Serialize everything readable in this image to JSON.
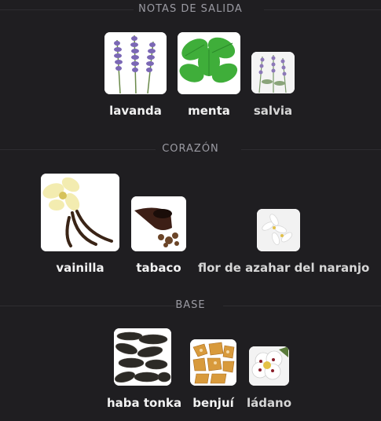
{
  "sections": {
    "top": {
      "title": "NOTAS DE SALIDA",
      "notes": [
        {
          "label": "lavanda",
          "icon": "lavender-image"
        },
        {
          "label": "menta",
          "icon": "mint-image"
        },
        {
          "label": "salvia",
          "icon": "sage-image"
        }
      ]
    },
    "heart": {
      "title": "CORAZÓN",
      "notes": [
        {
          "label": "vainilla",
          "icon": "vanilla-image"
        },
        {
          "label": "tabaco",
          "icon": "tobacco-pipe-image"
        },
        {
          "label": "flor de azahar del naranjo",
          "icon": "orange-blossom-image"
        }
      ]
    },
    "base": {
      "title": "BASE",
      "notes": [
        {
          "label": "haba tonka",
          "icon": "tonka-bean-image"
        },
        {
          "label": "benjuí",
          "icon": "benzoin-image"
        },
        {
          "label": "ládano",
          "icon": "labdanum-image"
        }
      ]
    }
  },
  "colors": {
    "background": "#1f1e21",
    "divider": "#2e2d31",
    "section_title": "#9b9ba3"
  }
}
